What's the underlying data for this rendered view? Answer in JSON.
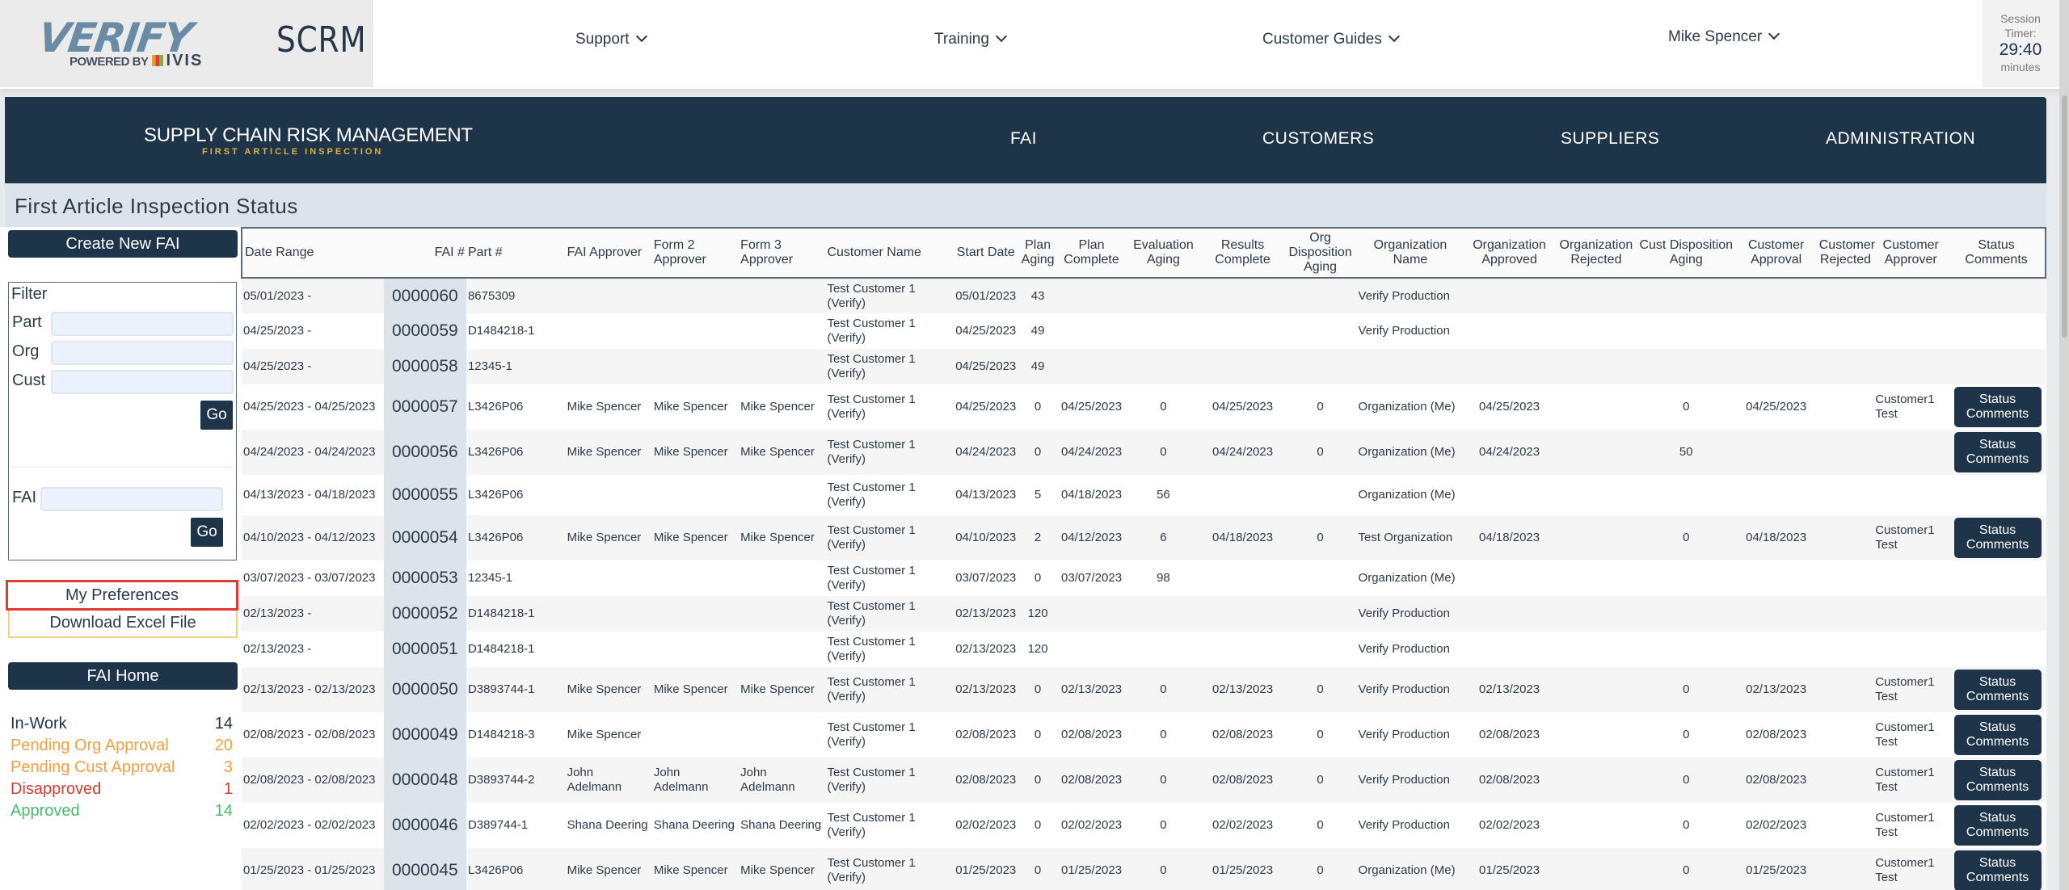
{
  "topbar": {
    "logo_text": "VERIFY",
    "logo_powered": "POWERED BY",
    "logo_ivis": "IVIS",
    "app_name": "SCRM",
    "nav": [
      {
        "label": "Support",
        "icon": "chevron-down-icon"
      },
      {
        "label": "Training",
        "icon": "chevron-down-icon"
      },
      {
        "label": "Customer Guides",
        "icon": "chevron-down-icon"
      },
      {
        "label": "Mike Spencer",
        "icon": "chevron-down-icon"
      }
    ],
    "session": {
      "label1": "Session",
      "label2": "Timer:",
      "value": "29:40",
      "unit": "minutes"
    }
  },
  "mainnav": {
    "title": "SUPPLY CHAIN RISK MANAGEMENT",
    "subtitle": "FIRST ARTICLE INSPECTION",
    "items": [
      "FAI",
      "CUSTOMERS",
      "SUPPLIERS",
      "ADMINISTRATION"
    ]
  },
  "page_title": "First Article Inspection Status",
  "sidebar": {
    "create_button": "Create New FAI",
    "filter": {
      "title": "Filter",
      "part_label": "Part",
      "part_value": "",
      "org_label": "Org",
      "org_value": "",
      "cust_label": "Cust",
      "cust_value": "",
      "go_label": "Go",
      "fai_label": "FAI",
      "fai_value": "",
      "fai_go_label": "Go"
    },
    "preferences_button": "My Preferences",
    "excel_button": "Download Excel File",
    "home_button": "FAI Home",
    "stats": [
      {
        "label": "In-Work",
        "count": "14",
        "color": "#1e3449"
      },
      {
        "label": "Pending Org Approval",
        "count": "20",
        "color": "#f0a040"
      },
      {
        "label": "Pending Cust Approval",
        "count": "3",
        "color": "#f0a040"
      },
      {
        "label": "Disapproved",
        "count": "1",
        "color": "#d04030"
      },
      {
        "label": "Approved",
        "count": "14",
        "color": "#4cb870"
      }
    ]
  },
  "table": {
    "headers": [
      "Date Range",
      "FAI #",
      "Part #",
      "FAI Approver",
      "Form 2 Approver",
      "Form 3 Approver",
      "Customer Name",
      "Start Date",
      "Plan Aging",
      "Plan Complete",
      "Evaluation Aging",
      "Results Complete",
      "Org Disposition Aging",
      "Organization Name",
      "Organization Approved",
      "Organization Rejected",
      "Cust Disposition Aging",
      "Customer Approval",
      "Customer Rejected",
      "Customer Approver",
      "Status Comments"
    ],
    "status_button_label": "Status Comments",
    "rows": [
      {
        "date_range": "05/01/2023 -",
        "fai": "0000060",
        "part": "8675309",
        "fai_approver": "",
        "form2": "",
        "form3": "",
        "customer": "Test Customer 1 (Verify)",
        "start": "05/01/2023",
        "plan_aging": "43",
        "plan_complete": "",
        "eval_aging": "",
        "results_complete": "",
        "org_disp_aging": "",
        "org_name": "Verify Production",
        "org_approved": "",
        "org_rejected": "",
        "cust_disp_aging": "",
        "cust_approval": "",
        "cust_rejected": "",
        "cust_approver": "",
        "has_status": false
      },
      {
        "date_range": "04/25/2023 -",
        "fai": "0000059",
        "part": "D1484218-1",
        "fai_approver": "",
        "form2": "",
        "form3": "",
        "customer": "Test Customer 1 (Verify)",
        "start": "04/25/2023",
        "plan_aging": "49",
        "plan_complete": "",
        "eval_aging": "",
        "results_complete": "",
        "org_disp_aging": "",
        "org_name": "Verify Production",
        "org_approved": "",
        "org_rejected": "",
        "cust_disp_aging": "",
        "cust_approval": "",
        "cust_rejected": "",
        "cust_approver": "",
        "has_status": false
      },
      {
        "date_range": "04/25/2023 -",
        "fai": "0000058",
        "part": "12345-1",
        "fai_approver": "",
        "form2": "",
        "form3": "",
        "customer": "Test Customer 1 (Verify)",
        "start": "04/25/2023",
        "plan_aging": "49",
        "plan_complete": "",
        "eval_aging": "",
        "results_complete": "",
        "org_disp_aging": "",
        "org_name": "",
        "org_approved": "",
        "org_rejected": "",
        "cust_disp_aging": "",
        "cust_approval": "",
        "cust_rejected": "",
        "cust_approver": "",
        "has_status": false
      },
      {
        "date_range": "04/25/2023 - 04/25/2023",
        "fai": "0000057",
        "part": "L3426P06",
        "fai_approver": "Mike Spencer",
        "form2": "Mike Spencer",
        "form3": "Mike Spencer",
        "customer": "Test Customer 1 (Verify)",
        "start": "04/25/2023",
        "plan_aging": "0",
        "plan_complete": "04/25/2023",
        "eval_aging": "0",
        "results_complete": "04/25/2023",
        "org_disp_aging": "0",
        "org_name": "Organization (Me)",
        "org_approved": "04/25/2023",
        "org_rejected": "",
        "cust_disp_aging": "0",
        "cust_approval": "04/25/2023",
        "cust_rejected": "",
        "cust_approver": "Customer1 Test",
        "has_status": true
      },
      {
        "date_range": "04/24/2023 - 04/24/2023",
        "fai": "0000056",
        "part": "L3426P06",
        "fai_approver": "Mike Spencer",
        "form2": "Mike Spencer",
        "form3": "Mike Spencer",
        "customer": "Test Customer 1 (Verify)",
        "start": "04/24/2023",
        "plan_aging": "0",
        "plan_complete": "04/24/2023",
        "eval_aging": "0",
        "results_complete": "04/24/2023",
        "org_disp_aging": "0",
        "org_name": "Organization (Me)",
        "org_approved": "04/24/2023",
        "org_rejected": "",
        "cust_disp_aging": "50",
        "cust_approval": "",
        "cust_rejected": "",
        "cust_approver": "",
        "has_status": true
      },
      {
        "date_range": "04/13/2023 - 04/18/2023",
        "fai": "0000055",
        "part": "L3426P06",
        "fai_approver": "",
        "form2": "",
        "form3": "",
        "customer": "Test Customer 1 (Verify)",
        "start": "04/13/2023",
        "plan_aging": "5",
        "plan_complete": "04/18/2023",
        "eval_aging": "56",
        "results_complete": "",
        "org_disp_aging": "",
        "org_name": "Organization (Me)",
        "org_approved": "",
        "org_rejected": "",
        "cust_disp_aging": "",
        "cust_approval": "",
        "cust_rejected": "",
        "cust_approver": "",
        "has_status": false
      },
      {
        "date_range": "04/10/2023 - 04/12/2023",
        "fai": "0000054",
        "part": "L3426P06",
        "fai_approver": "Mike Spencer",
        "form2": "Mike Spencer",
        "form3": "Mike Spencer",
        "customer": "Test Customer 1 (Verify)",
        "start": "04/10/2023",
        "plan_aging": "2",
        "plan_complete": "04/12/2023",
        "eval_aging": "6",
        "results_complete": "04/18/2023",
        "org_disp_aging": "0",
        "org_name": "Test Organization",
        "org_approved": "04/18/2023",
        "org_rejected": "",
        "cust_disp_aging": "0",
        "cust_approval": "04/18/2023",
        "cust_rejected": "",
        "cust_approver": "Customer1 Test",
        "has_status": true
      },
      {
        "date_range": "03/07/2023 - 03/07/2023",
        "fai": "0000053",
        "part": "12345-1",
        "fai_approver": "",
        "form2": "",
        "form3": "",
        "customer": "Test Customer 1 (Verify)",
        "start": "03/07/2023",
        "plan_aging": "0",
        "plan_complete": "03/07/2023",
        "eval_aging": "98",
        "results_complete": "",
        "org_disp_aging": "",
        "org_name": "Organization (Me)",
        "org_approved": "",
        "org_rejected": "",
        "cust_disp_aging": "",
        "cust_approval": "",
        "cust_rejected": "",
        "cust_approver": "",
        "has_status": false
      },
      {
        "date_range": "02/13/2023 -",
        "fai": "0000052",
        "part": "D1484218-1",
        "fai_approver": "",
        "form2": "",
        "form3": "",
        "customer": "Test Customer 1 (Verify)",
        "start": "02/13/2023",
        "plan_aging": "120",
        "plan_complete": "",
        "eval_aging": "",
        "results_complete": "",
        "org_disp_aging": "",
        "org_name": "Verify Production",
        "org_approved": "",
        "org_rejected": "",
        "cust_disp_aging": "",
        "cust_approval": "",
        "cust_rejected": "",
        "cust_approver": "",
        "has_status": false
      },
      {
        "date_range": "02/13/2023 -",
        "fai": "0000051",
        "part": "D1484218-1",
        "fai_approver": "",
        "form2": "",
        "form3": "",
        "customer": "Test Customer 1 (Verify)",
        "start": "02/13/2023",
        "plan_aging": "120",
        "plan_complete": "",
        "eval_aging": "",
        "results_complete": "",
        "org_disp_aging": "",
        "org_name": "Verify Production",
        "org_approved": "",
        "org_rejected": "",
        "cust_disp_aging": "",
        "cust_approval": "",
        "cust_rejected": "",
        "cust_approver": "",
        "has_status": false
      },
      {
        "date_range": "02/13/2023 - 02/13/2023",
        "fai": "0000050",
        "part": "D3893744-1",
        "fai_approver": "Mike Spencer",
        "form2": "Mike Spencer",
        "form3": "Mike Spencer",
        "customer": "Test Customer 1 (Verify)",
        "start": "02/13/2023",
        "plan_aging": "0",
        "plan_complete": "02/13/2023",
        "eval_aging": "0",
        "results_complete": "02/13/2023",
        "org_disp_aging": "0",
        "org_name": "Verify Production",
        "org_approved": "02/13/2023",
        "org_rejected": "",
        "cust_disp_aging": "0",
        "cust_approval": "02/13/2023",
        "cust_rejected": "",
        "cust_approver": "Customer1 Test",
        "has_status": true
      },
      {
        "date_range": "02/08/2023 - 02/08/2023",
        "fai": "0000049",
        "part": "D1484218-3",
        "fai_approver": "Mike Spencer",
        "form2": "",
        "form3": "",
        "customer": "Test Customer 1 (Verify)",
        "start": "02/08/2023",
        "plan_aging": "0",
        "plan_complete": "02/08/2023",
        "eval_aging": "0",
        "results_complete": "02/08/2023",
        "org_disp_aging": "0",
        "org_name": "Verify Production",
        "org_approved": "02/08/2023",
        "org_rejected": "",
        "cust_disp_aging": "0",
        "cust_approval": "02/08/2023",
        "cust_rejected": "",
        "cust_approver": "Customer1 Test",
        "has_status": true
      },
      {
        "date_range": "02/08/2023 - 02/08/2023",
        "fai": "0000048",
        "part": "D3893744-2",
        "fai_approver": "John Adelmann",
        "form2": "John Adelmann",
        "form3": "John Adelmann",
        "customer": "Test Customer 1 (Verify)",
        "start": "02/08/2023",
        "plan_aging": "0",
        "plan_complete": "02/08/2023",
        "eval_aging": "0",
        "results_complete": "02/08/2023",
        "org_disp_aging": "0",
        "org_name": "Verify Production",
        "org_approved": "02/08/2023",
        "org_rejected": "",
        "cust_disp_aging": "0",
        "cust_approval": "02/08/2023",
        "cust_rejected": "",
        "cust_approver": "Customer1 Test",
        "has_status": true
      },
      {
        "date_range": "02/02/2023 - 02/02/2023",
        "fai": "0000046",
        "part": "D389744-1",
        "fai_approver": "Shana Deering",
        "form2": "Shana Deering",
        "form3": "Shana Deering",
        "customer": "Test Customer 1 (Verify)",
        "start": "02/02/2023",
        "plan_aging": "0",
        "plan_complete": "02/02/2023",
        "eval_aging": "0",
        "results_complete": "02/02/2023",
        "org_disp_aging": "0",
        "org_name": "Verify Production",
        "org_approved": "02/02/2023",
        "org_rejected": "",
        "cust_disp_aging": "0",
        "cust_approval": "02/02/2023",
        "cust_rejected": "",
        "cust_approver": "Customer1 Test",
        "has_status": true
      },
      {
        "date_range": "01/25/2023 - 01/25/2023",
        "fai": "0000045",
        "part": "L3426P06",
        "fai_approver": "Mike Spencer",
        "form2": "Mike Spencer",
        "form3": "Mike Spencer",
        "customer": "Test Customer 1 (Verify)",
        "start": "01/25/2023",
        "plan_aging": "0",
        "plan_complete": "01/25/2023",
        "eval_aging": "0",
        "results_complete": "01/25/2023",
        "org_disp_aging": "0",
        "org_name": "Organization (Me)",
        "org_approved": "01/25/2023",
        "org_rejected": "",
        "cust_disp_aging": "0",
        "cust_approval": "01/25/2023",
        "cust_rejected": "",
        "cust_approver": "Customer1 Test",
        "has_status": true
      }
    ]
  }
}
